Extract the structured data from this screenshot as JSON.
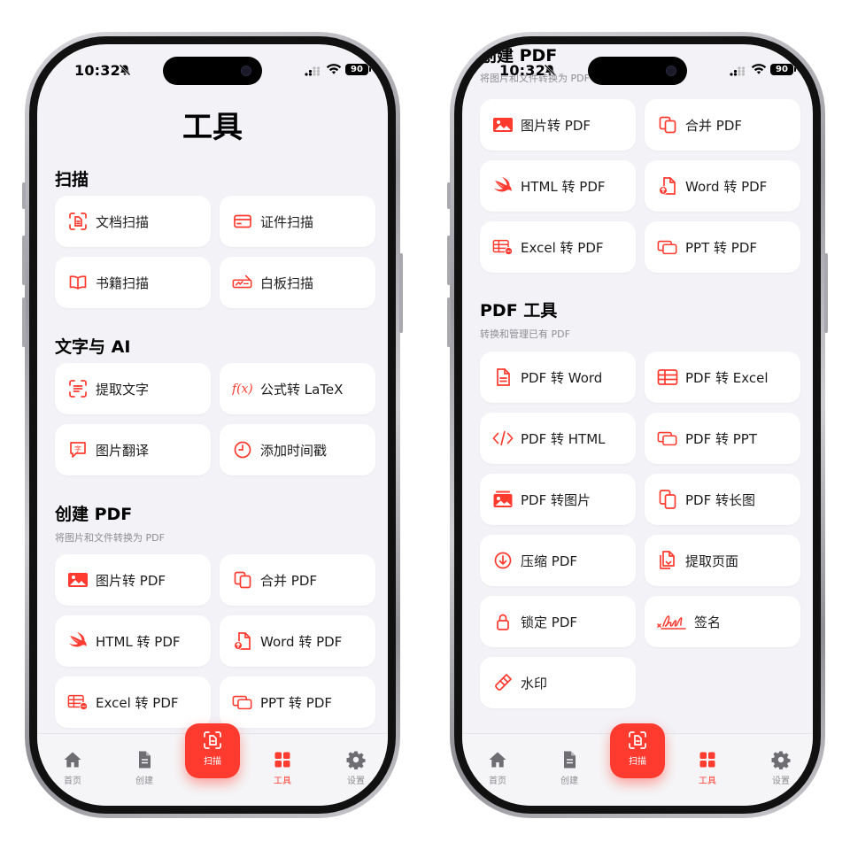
{
  "status": {
    "time": "10:32",
    "battery": "90"
  },
  "colors": {
    "accent": "#ff3b30",
    "background": "#f2f2f7",
    "card": "#ffffff"
  },
  "page_title": "工具",
  "sections": {
    "scan": {
      "title": "扫描",
      "items": [
        "文档扫描",
        "证件扫描",
        "书籍扫描",
        "白板扫描"
      ]
    },
    "text_ai": {
      "title": "文字与 AI",
      "items": [
        "提取文字",
        "公式转 LaTeX",
        "图片翻译",
        "添加时间戳"
      ]
    },
    "create_pdf": {
      "title": "创建 PDF",
      "subtitle": "将图片和文件转换为 PDF",
      "items": [
        "图片转 PDF",
        "合并 PDF",
        "HTML 转 PDF",
        "Word 转 PDF",
        "Excel 转 PDF",
        "PPT 转 PDF"
      ]
    },
    "pdf_tools": {
      "title": "PDF 工具",
      "subtitle": "转换和管理已有 PDF",
      "items": [
        "PDF 转 Word",
        "PDF 转 Excel",
        "PDF 转 HTML",
        "PDF 转 PPT",
        "PDF 转图片",
        "PDF 转长图",
        "压缩 PDF",
        "提取页面",
        "锁定 PDF",
        "签名",
        "水印"
      ]
    }
  },
  "tabbar": {
    "home": "首页",
    "create": "创建",
    "scan": "扫描",
    "tools": "工具",
    "settings": "设置"
  },
  "icons": [
    "bell-slash-icon",
    "signal-icon",
    "wifi-icon",
    "document-scan-icon",
    "id-card-icon",
    "book-icon",
    "whiteboard-icon",
    "text-extract-icon",
    "formula-icon",
    "translate-icon",
    "clock-icon",
    "image-icon",
    "merge-icon",
    "swift-icon",
    "word-file-icon",
    "excel-icon",
    "ppt-icon",
    "document-icon",
    "table-icon",
    "code-icon",
    "image-stack-icon",
    "long-image-icon",
    "compress-icon",
    "extract-pages-icon",
    "lock-icon",
    "signature-icon",
    "watermark-icon",
    "home-icon",
    "create-icon",
    "grid-icon",
    "gear-icon"
  ]
}
